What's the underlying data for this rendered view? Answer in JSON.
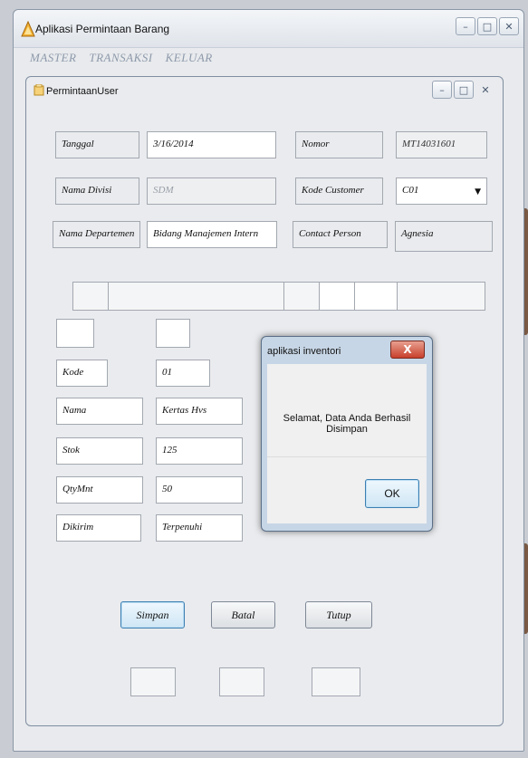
{
  "app": {
    "title": "Aplikasi Permintaan Barang",
    "window_buttons": {
      "minimize": "–",
      "maximize": "□",
      "close": "✕"
    }
  },
  "menu": [
    "MASTER",
    "TRANSAKSI",
    "KELUAR"
  ],
  "child_window": {
    "title": "PermintaanUser",
    "window_buttons": {
      "minimize": "–",
      "maximize": "□",
      "close": "✕"
    }
  },
  "form": {
    "tanggal_label": "Tanggal",
    "tanggal_value": "3/16/2014",
    "nomor_label": "Nomor",
    "nomor_value": "MT14031601",
    "divisi_label": "Nama Divisi",
    "divisi_value": "SDM",
    "customer_label": "Kode Customer",
    "customer_value": "C01",
    "departemen_label": "Nama Departemen",
    "departemen_value": "Bidang Manajemen Intern",
    "contact_label": "Contact Person",
    "contact_value": "Agnesia"
  },
  "item": {
    "kode_label": "Kode",
    "kode_value": "01",
    "nama_label": "Nama",
    "nama_value": "Kertas Hvs",
    "stok_label": "Stok",
    "stok_value": "125",
    "qty_label": "QtyMnt",
    "qty_value": "50",
    "dikirim_label": "Dikirim",
    "dikirim_value": "Terpenuhi"
  },
  "buttons": {
    "save": "Simpan",
    "cancel": "Batal",
    "close": "Tutup"
  },
  "dialog": {
    "title": "aplikasi inventori",
    "close": "X",
    "message": "Selamat, Data Anda Berhasil Disimpan",
    "ok": "OK"
  },
  "icons": {
    "app": "app-logo-icon",
    "child": "form-icon",
    "dropdown": "chevron-down-icon"
  },
  "colors": {
    "menu_text": "#8e9aab",
    "dialog_close": "#c8402c",
    "primary_button_border": "#3c7fb1"
  }
}
